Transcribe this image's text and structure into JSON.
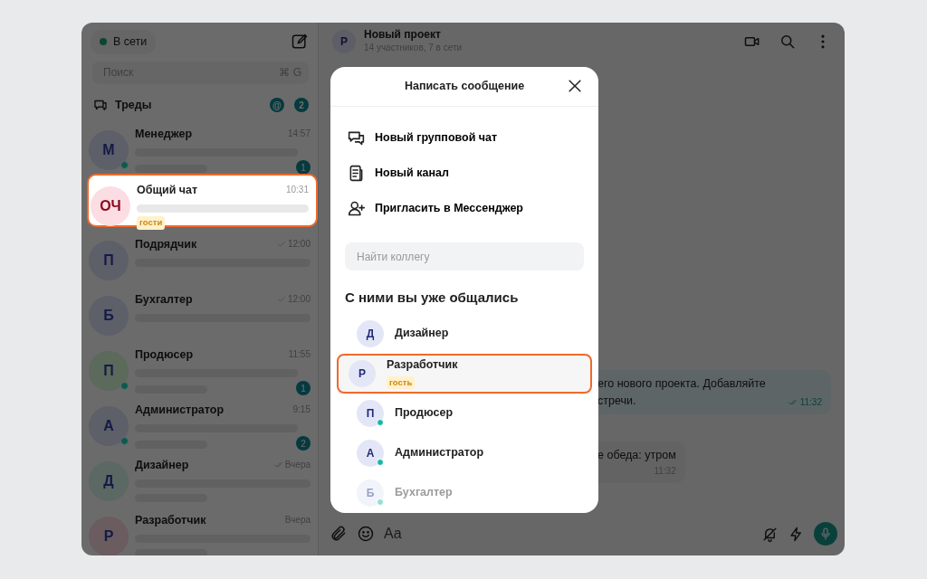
{
  "sidebar": {
    "status": {
      "label": "В сети",
      "online": true
    },
    "search": {
      "placeholder": "Поиск",
      "shortcut": [
        "⌘",
        "G"
      ]
    },
    "threads": {
      "label": "Треды",
      "mention_badge": "@",
      "count_badge": "2"
    },
    "chats": [
      {
        "initials": "М",
        "color": "#5d5f69",
        "name": "Менеджер",
        "time": "14:57",
        "sent": false,
        "read": false,
        "online": true,
        "unread": "1",
        "short_preview": false,
        "highlighted": false
      },
      {
        "initials": "ОЧ",
        "color": "#fcdde3",
        "name": "Общий чат",
        "time": "10:31",
        "sent": false,
        "read": false,
        "online": false,
        "tag": "гости",
        "short_preview": true,
        "highlighted": true
      },
      {
        "initials": "П",
        "color": "#5d5f69",
        "name": "Подрядчик",
        "time": "12:00",
        "sent": true,
        "read": false,
        "online": false,
        "short_preview": true,
        "highlighted": false
      },
      {
        "initials": "Б",
        "color": "#5d5f69",
        "name": "Бухгалтер",
        "time": "12:00",
        "sent": true,
        "read": false,
        "online": false,
        "short_preview": true,
        "highlighted": false
      },
      {
        "initials": "П",
        "color": "#5b6a5a",
        "name": "Продюсер",
        "time": "11:55",
        "sent": false,
        "read": false,
        "online": true,
        "unread": "1",
        "short_preview": false,
        "highlighted": false
      },
      {
        "initials": "А",
        "color": "#5d5f69",
        "name": "Администратор",
        "time": "9:15",
        "sent": false,
        "read": false,
        "online": true,
        "unread": "2",
        "short_preview": false,
        "highlighted": false
      },
      {
        "initials": "Д",
        "color": "#5b6864",
        "name": "Дизайнер",
        "time": "Вчера",
        "sent": true,
        "read": true,
        "online": false,
        "short_preview": false,
        "highlighted": false
      },
      {
        "initials": "Р",
        "color": "#6a5c5f",
        "name": "Разработчик",
        "time": "Вчера",
        "sent": false,
        "read": false,
        "online": false,
        "highlighted": false
      }
    ]
  },
  "chat": {
    "header": {
      "initials": "Р",
      "title": "Новый проект",
      "subtitle": "14 участников, 7 в сети"
    },
    "messages": [
      {
        "kind": "outgoing",
        "lines": [
          "его нового проекта. Добавляйте",
          "стречи."
        ],
        "time": "11:32",
        "read": true
      },
      {
        "kind": "incoming",
        "lines": [
          "е обеда: утром"
        ],
        "time": "11:32",
        "read": false
      }
    ],
    "composer": {
      "format_label": "Aa"
    }
  },
  "modal": {
    "title": "Написать сообщение",
    "actions": [
      {
        "kind": "group-chat",
        "label": "Новый групповой чат"
      },
      {
        "kind": "channel",
        "label": "Новый канал"
      },
      {
        "kind": "invite",
        "label": "Пригласить в Мессенджер"
      }
    ],
    "search": {
      "placeholder": "Найти коллегу"
    },
    "section_title": "С ними вы уже общались",
    "contacts": [
      {
        "initials": "Д",
        "name": "Дизайнер",
        "online": false,
        "highlighted": false,
        "faded": false
      },
      {
        "initials": "Р",
        "name": "Разработчик",
        "tag": "гость",
        "online": false,
        "highlighted": true,
        "faded": false
      },
      {
        "initials": "П",
        "name": "Продюсер",
        "online": true,
        "highlighted": false,
        "faded": false
      },
      {
        "initials": "А",
        "name": "Администратор",
        "online": true,
        "highlighted": false,
        "faded": false
      },
      {
        "initials": "Б",
        "name": "Бухгалтер",
        "online": true,
        "highlighted": false,
        "faded": true
      }
    ]
  }
}
